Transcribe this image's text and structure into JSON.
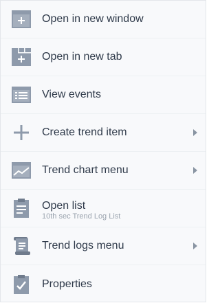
{
  "colors": {
    "icon": "#8e9aab",
    "text": "#2f3a4a",
    "subtext": "#9aa3ae",
    "background": "#f8f9fb"
  },
  "menu": {
    "items": [
      {
        "label": "Open in new window",
        "icon": "new-window-icon"
      },
      {
        "label": "Open in new tab",
        "icon": "new-tab-icon"
      },
      {
        "label": "View events",
        "icon": "events-list-icon"
      },
      {
        "label": "Create trend item",
        "icon": "plus-icon",
        "has_submenu": true
      },
      {
        "label": "Trend chart menu",
        "icon": "trend-chart-icon",
        "has_submenu": true
      },
      {
        "label": "Open list",
        "sublabel": "10th sec Trend Log List",
        "icon": "clipboard-icon"
      },
      {
        "label": "Trend logs menu",
        "icon": "scroll-icon",
        "has_submenu": true
      },
      {
        "label": "Properties",
        "icon": "properties-check-icon"
      }
    ]
  }
}
